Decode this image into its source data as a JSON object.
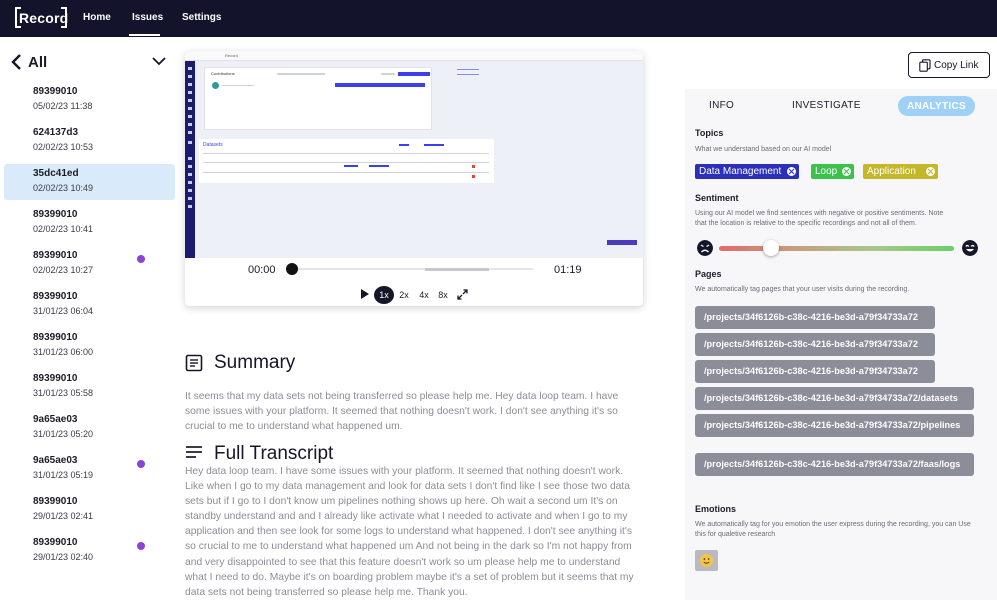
{
  "nav": {
    "logo": "Record",
    "items": [
      "Home",
      "Issues",
      "Settings"
    ],
    "active": "Issues"
  },
  "sidebar": {
    "title": "All",
    "recordings": [
      {
        "id": "89399010",
        "date": "05/02/23 11:38",
        "unread": false,
        "active": false
      },
      {
        "id": "624137d3",
        "date": "02/02/23 10:53",
        "unread": false,
        "active": false
      },
      {
        "id": "35dc41ed",
        "date": "02/02/23 10:49",
        "unread": false,
        "active": true
      },
      {
        "id": "89399010",
        "date": "02/02/23 10:41",
        "unread": false,
        "active": false
      },
      {
        "id": "89399010",
        "date": "02/02/23 10:27",
        "unread": true,
        "active": false
      },
      {
        "id": "89399010",
        "date": "31/01/23 06:04",
        "unread": false,
        "active": false
      },
      {
        "id": "89399010",
        "date": "31/01/23 06:00",
        "unread": false,
        "active": false
      },
      {
        "id": "89399010",
        "date": "31/01/23 05:58",
        "unread": false,
        "active": false
      },
      {
        "id": "9a65ae03",
        "date": "31/01/23 05:20",
        "unread": false,
        "active": false
      },
      {
        "id": "9a65ae03",
        "date": "31/01/23 05:19",
        "unread": true,
        "active": false
      },
      {
        "id": "89399010",
        "date": "29/01/23 02:41",
        "unread": false,
        "active": false
      },
      {
        "id": "89399010",
        "date": "29/01/23 02:40",
        "unread": true,
        "active": false
      }
    ]
  },
  "player": {
    "current_time": "00:00",
    "duration": "01:19",
    "progress": 0,
    "speeds": [
      "1x",
      "2x",
      "4x",
      "8x"
    ],
    "selected_speed": "1x",
    "screenshot": {
      "browser_title": "Record",
      "panel_title": "Contributions",
      "datasets_title": "Datasets"
    }
  },
  "summary": {
    "title": "Summary",
    "text": "It seems that my data sets not being transferred so please help me. Hey data loop team. I have some issues with your platform. It seemed that nothing doesn't work. I don't see anything it's so crucial to me to understand what happened um."
  },
  "transcript": {
    "title": "Full Transcript",
    "text": "Hey data loop team. I have some issues with your platform. It seemed that nothing doesn't work. Like when I go to my data management and look for data sets I don't find like I see those two data sets but if I go to I don't know um pipelines nothing shows up here. Oh wait a second um It's on standby understand and and I already like activate what I needed to activate and when I go to my application and then see look for some logs to understand what happened. I don't see anything it's so crucial to me to understand what happened um And not being in the dark so I'm not happy from and very disappointed to see that this feature doesn't work so um please help me to understand what I need to do. Maybe it's on boarding problem maybe it's a set of problem but it seems that my data sets not being transferred so please help me. Thank you."
  },
  "copy_link": "Copy Link",
  "analytics": {
    "tabs": [
      "INFO",
      "INVESTIGATE",
      "ANALYTICS"
    ],
    "active_tab": "ANALYTICS",
    "topics": {
      "title": "Topics",
      "desc": "What we understand based on our AI model",
      "items": [
        {
          "label": "Data Management",
          "color": "#2c2fb8"
        },
        {
          "label": "Loop",
          "color": "#3cc24a"
        },
        {
          "label": "Application",
          "color": "#c5b72a"
        }
      ]
    },
    "sentiment": {
      "title": "Sentiment",
      "desc": "Using our AI model we find sentences with negative or positive sentiments. Note that the location is relative to the specific recordings and not all of them.",
      "value": 0.22
    },
    "pages": {
      "title": "Pages",
      "desc": "We automatically tag pages that your user visits during the recording.",
      "items": [
        "/projects/34f6126b-c38c-4216-be3d-a79f34733a72",
        "/projects/34f6126b-c38c-4216-be3d-a79f34733a72",
        "/projects/34f6126b-c38c-4216-be3d-a79f34733a72",
        "/projects/34f6126b-c38c-4216-be3d-a79f34733a72/datasets",
        "/projects/34f6126b-c38c-4216-be3d-a79f34733a72/pipelines",
        "/projects/34f6126b-c38c-4216-be3d-a79f34733a72/faas/logs"
      ]
    },
    "emotions": {
      "title": "Emotions",
      "desc": "We automatically tag for you emotion the user express during the recording, you can Use this for qualetive research",
      "items": [
        "smiling-face-icon"
      ]
    }
  }
}
